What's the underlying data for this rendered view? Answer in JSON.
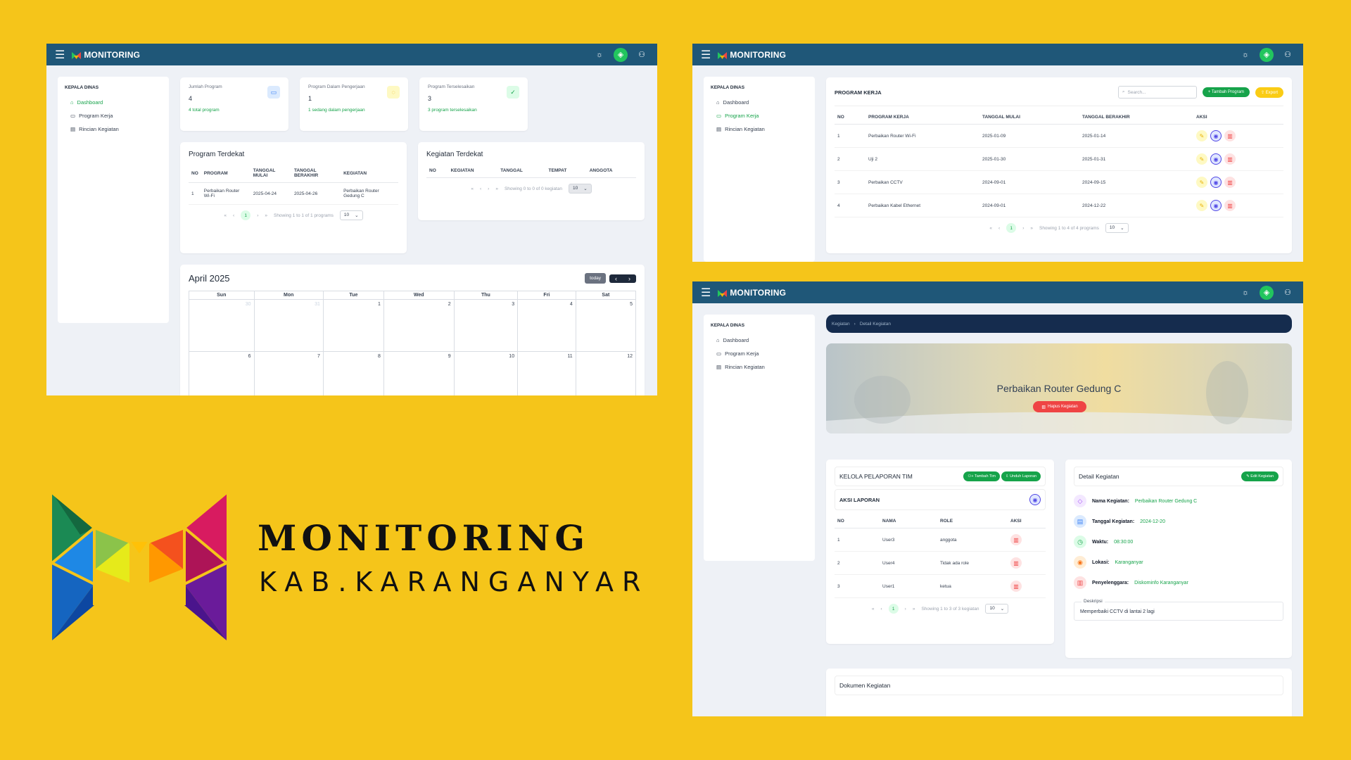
{
  "app": {
    "title": "MONITORING"
  },
  "sidebar": {
    "header": "KEPALA DINAS",
    "items": [
      "Dashboard",
      "Program Kerja",
      "Rincian Kegiatan"
    ]
  },
  "dashboard": {
    "stats": [
      {
        "label": "Jumlah Program",
        "value": "4",
        "sub": "4 total program",
        "color": "#3b82f6",
        "bg": "#dbeafe",
        "icon": "folder-icon"
      },
      {
        "label": "Program Dalam Pengerjaan",
        "value": "1",
        "sub": "1 sedang dalam pengerjaan",
        "color": "#eab308",
        "bg": "#fef9c3",
        "icon": "spinner-icon"
      },
      {
        "label": "Program Terselesaikan",
        "value": "3",
        "sub": "3 program terselesaikan",
        "color": "#16a34a",
        "bg": "#dcfce7",
        "icon": "check-icon"
      }
    ],
    "program_terdekat": {
      "title": "Program Terdekat",
      "headers": [
        "NO",
        "PROGRAM",
        "TANGGAL MULAI",
        "TANGGAL BERAKHIR",
        "KEGIATAN"
      ],
      "rows": [
        [
          "1",
          "Perbaikan Router Wi-Fi",
          "2025-04-24",
          "2025-04-26",
          "Perbaikan Router Gedung C"
        ]
      ],
      "showing": "Showing 1 to 1 of 1 programs",
      "page": "1",
      "per_page": "10"
    },
    "kegiatan_terdekat": {
      "title": "Kegiatan Terdekat",
      "headers": [
        "NO",
        "KEGIATAN",
        "TANGGAL",
        "TEMPAT",
        "ANGGOTA"
      ],
      "showing": "Showing 0 to 0 of 0 kegiatan",
      "per_page": "10"
    },
    "calendar": {
      "title": "April 2025",
      "today": "today",
      "days": [
        "Sun",
        "Mon",
        "Tue",
        "Wed",
        "Thu",
        "Fri",
        "Sat"
      ],
      "weeks": [
        [
          "30",
          "31",
          "1",
          "2",
          "3",
          "4",
          "5"
        ],
        [
          "6",
          "7",
          "8",
          "9",
          "10",
          "11",
          "12"
        ]
      ]
    }
  },
  "program_kerja": {
    "title": "PROGRAM KERJA",
    "search_placeholder": "Search...",
    "add_label": "Tambah Program",
    "export_label": "Export",
    "headers": [
      "NO",
      "PROGRAM KERJA",
      "TANGGAL MULAI",
      "TANGGAL BERAKHIR",
      "AKSI"
    ],
    "rows": [
      [
        "1",
        "Perbaikan Router Wi-Fi",
        "2025-01-09",
        "2025-01-14"
      ],
      [
        "2",
        "Uji 2",
        "2025-01-30",
        "2025-01-31"
      ],
      [
        "3",
        "Perbaikan CCTV",
        "2024-09-01",
        "2024-09-15"
      ],
      [
        "4",
        "Perbaikan Kabel Ethernet",
        "2024-09-01",
        "2024-12-22"
      ]
    ],
    "showing": "Showing 1 to 4 of 4 programs",
    "page": "1",
    "per_page": "10"
  },
  "detail": {
    "breadcrumb": [
      "Kegiatan",
      "Detail Kegiatan"
    ],
    "hero_title": "Perbaikan Router Gedung C",
    "delete_label": "Hapus Kegiatan",
    "team": {
      "title": "KELOLA PELAPORAN TIM",
      "add_label": "Tambah Tim",
      "download_label": "Unduh Laporan",
      "aksi_title": "AKSI LAPORAN",
      "headers": [
        "NO",
        "NAMA",
        "ROLE",
        "AKSI"
      ],
      "rows": [
        [
          "1",
          "User3",
          "anggota"
        ],
        [
          "2",
          "User4",
          "Tidak ada role"
        ],
        [
          "3",
          "User1",
          "ketua"
        ]
      ],
      "showing": "Showing 1 to 3 of 3 kegiatan",
      "page": "1",
      "per_page": "10"
    },
    "info": {
      "title": "Detail Kegiatan",
      "edit_label": "Edit Kegiatan",
      "items": [
        {
          "label": "Nama Kegiatan:",
          "value": "Perbaikan Router Gedung C",
          "icon": "tag-icon",
          "color": "#a855f7",
          "bg": "#f3e8ff"
        },
        {
          "label": "Tanggal Kegiatan:",
          "value": "2024-12-20",
          "icon": "calendar-icon",
          "color": "#3b82f6",
          "bg": "#dbeafe"
        },
        {
          "label": "Waktu:",
          "value": "08:30:00",
          "icon": "clock-icon",
          "color": "#16a34a",
          "bg": "#dcfce7"
        },
        {
          "label": "Lokasi:",
          "value": "Karanganyar",
          "icon": "location-icon",
          "color": "#f97316",
          "bg": "#ffedd5"
        },
        {
          "label": "Penyelenggara:",
          "value": "Diskominfo Karanganyar",
          "icon": "building-icon",
          "color": "#ef4444",
          "bg": "#fee2e2"
        }
      ],
      "desc_label": "Deskripsi",
      "desc": "Memperbaiki CCTV di lantai 2 lagi"
    },
    "dokumen_title": "Dokumen Kegiatan"
  },
  "branding": {
    "title": "MONITORING",
    "subtitle": "KAB.KARANGANYAR"
  }
}
